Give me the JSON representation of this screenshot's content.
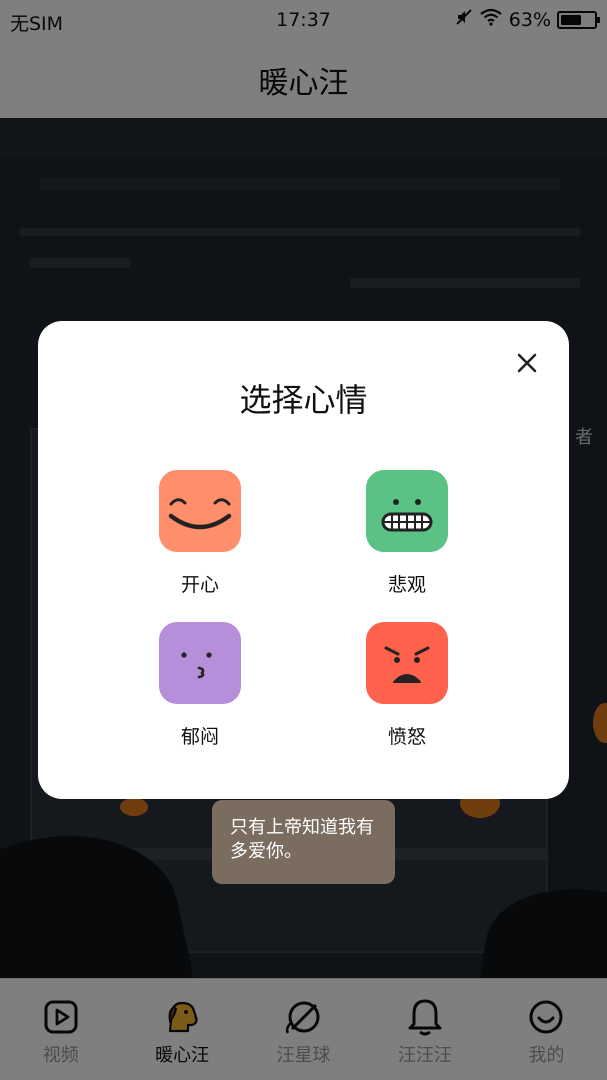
{
  "status_bar": {
    "carrier": "无SIM",
    "time": "17:37",
    "battery": "63%",
    "battery_level": 0.63,
    "icons": [
      "mute-icon",
      "wifi-icon",
      "battery-icon"
    ]
  },
  "header": {
    "title": "暖心汪"
  },
  "scene": {
    "side_label": "者"
  },
  "bubble": {
    "text": "只有上帝知道我有多爱你。"
  },
  "modal": {
    "title": "选择心情",
    "close_icon": "close-icon",
    "moods": [
      {
        "label": "开心",
        "icon": "happy-face-icon",
        "color": "#ff8f6a"
      },
      {
        "label": "悲观",
        "icon": "grimace-face-icon",
        "color": "#5ac285"
      },
      {
        "label": "郁闷",
        "icon": "gloomy-face-icon",
        "color": "#b68fdb"
      },
      {
        "label": "愤怒",
        "icon": "angry-face-icon",
        "color": "#ff624c"
      }
    ]
  },
  "tabbar": {
    "active_index": 1,
    "items": [
      {
        "label": "视频",
        "icon": "video-play-icon"
      },
      {
        "label": "暖心汪",
        "icon": "dog-icon"
      },
      {
        "label": "汪星球",
        "icon": "planet-icon"
      },
      {
        "label": "汪汪汪",
        "icon": "bell-icon"
      },
      {
        "label": "我的",
        "icon": "smiley-profile-icon"
      }
    ]
  }
}
